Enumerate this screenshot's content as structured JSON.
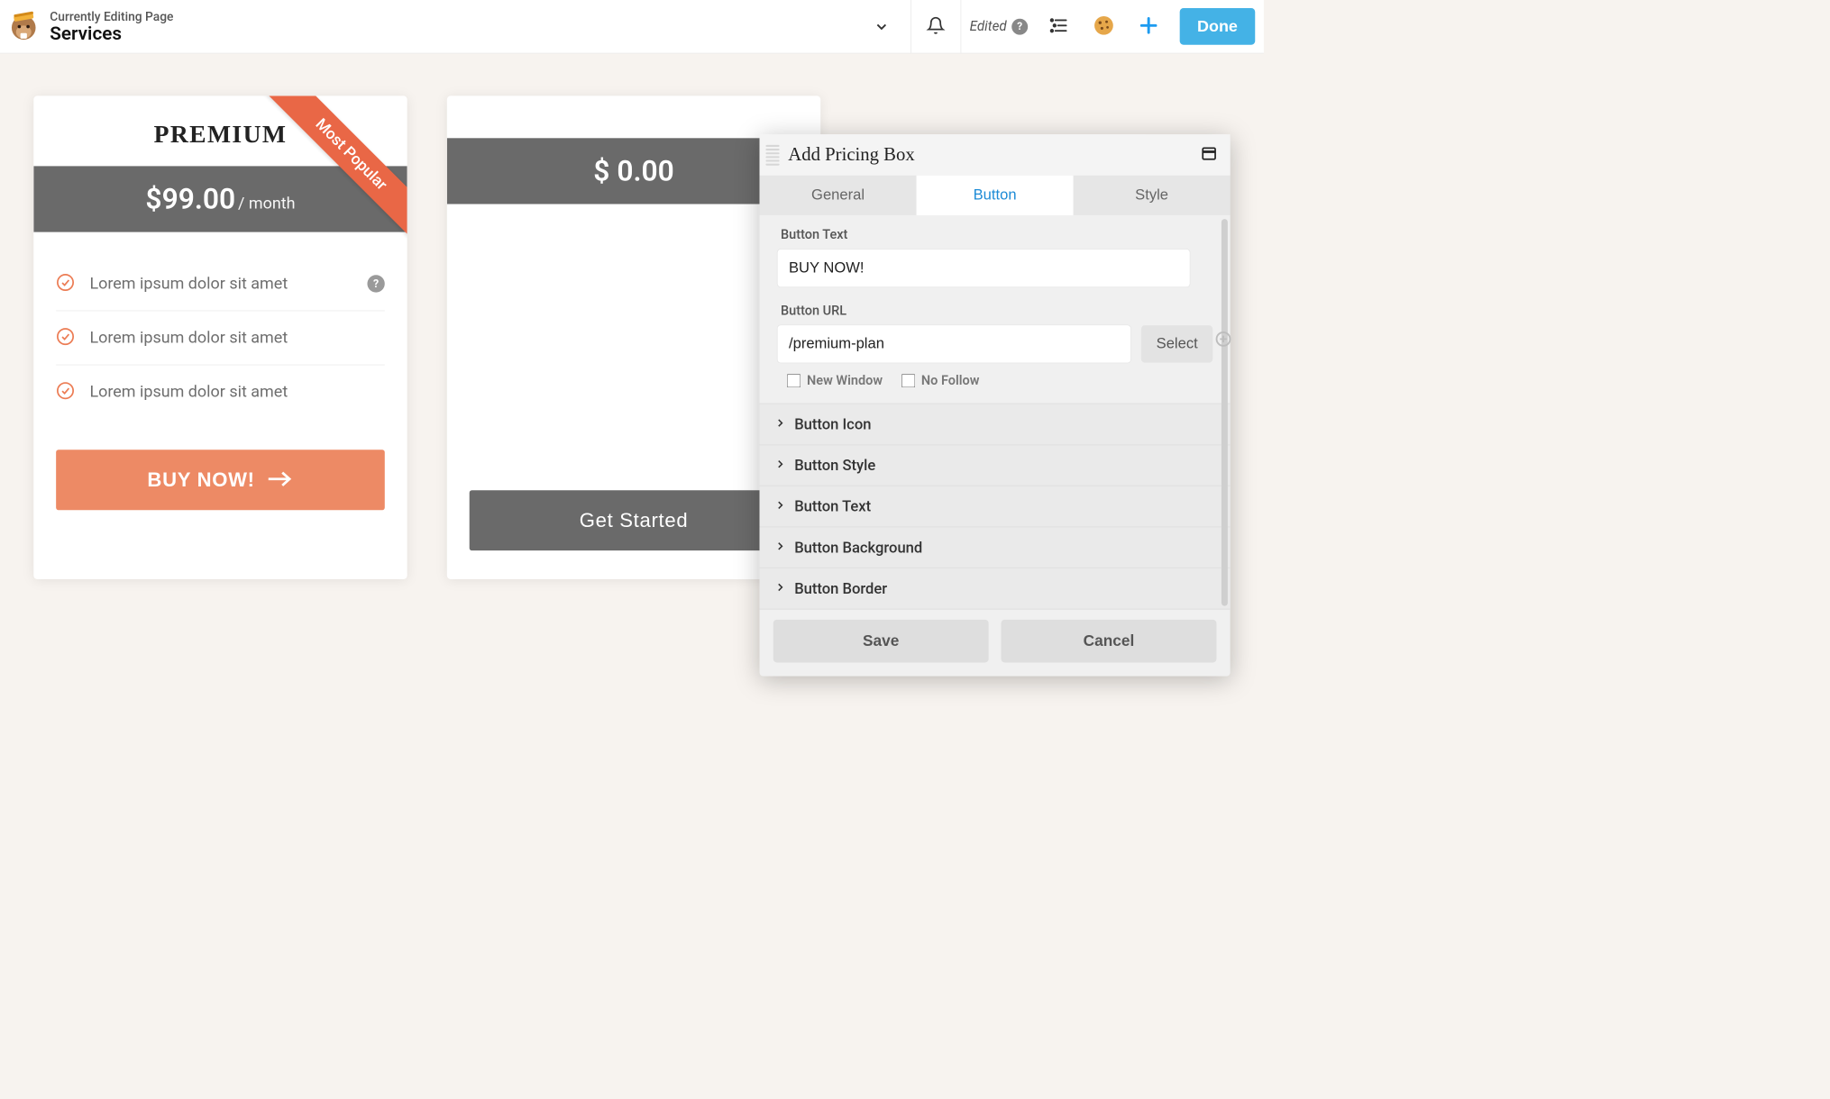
{
  "toolbar": {
    "subtitle": "Currently Editing Page",
    "title": "Services",
    "edited_label": "Edited",
    "done_label": "Done"
  },
  "cards": {
    "premium": {
      "title": "PREMIUM",
      "ribbon": "Most Popular",
      "currency": "$",
      "price": "99.00",
      "period": "/ month",
      "features": [
        "Lorem ipsum dolor sit amet",
        "Lorem ipsum dolor sit amet",
        "Lorem ipsum dolor sit amet"
      ],
      "cta": "BUY NOW!"
    },
    "plain": {
      "price_display": "$ 0.00",
      "cta": "Get Started"
    }
  },
  "panel": {
    "title": "Add Pricing Box",
    "tabs": {
      "general": "General",
      "button": "Button",
      "style": "Style"
    },
    "fields": {
      "button_text_label": "Button Text",
      "button_text_value": "BUY NOW!",
      "button_url_label": "Button URL",
      "button_url_value": "/premium-plan",
      "select_label": "Select",
      "new_window": "New Window",
      "no_follow": "No Follow"
    },
    "accordion": {
      "icon": "Button Icon",
      "style": "Button Style",
      "text": "Button Text",
      "background": "Button Background",
      "border": "Button Border"
    },
    "footer": {
      "save": "Save",
      "cancel": "Cancel"
    }
  }
}
